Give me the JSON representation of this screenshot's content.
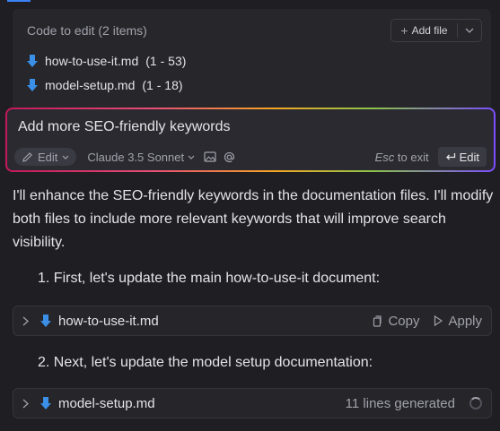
{
  "code_to_edit": {
    "header": "Code to edit (2 items)",
    "add_file_label": "Add file",
    "files": [
      {
        "name": "how-to-use-it.md",
        "range": "(1 - 53)"
      },
      {
        "name": "model-setup.md",
        "range": "(1 - 18)"
      }
    ]
  },
  "prompt": {
    "text": "Add more SEO-friendly keywords",
    "mode_label": "Edit",
    "model_label": "Claude 3.5 Sonnet",
    "esc_key": "Esc",
    "esc_hint": "to exit",
    "submit_label": "Edit"
  },
  "response": {
    "intro": "I'll enhance the SEO-friendly keywords in the documentation files. I'll modify both files to include more relevant keywords that will improve search visibility.",
    "step1": "1. First, let's update the main how-to-use-it document:",
    "step2": "2. Next, let's update the model setup documentation:"
  },
  "code_blocks": [
    {
      "name": "how-to-use-it.md",
      "copy_label": "Copy",
      "apply_label": "Apply"
    },
    {
      "name": "model-setup.md",
      "status": "11 lines generated"
    }
  ],
  "colors": {
    "background": "#1f1f23",
    "markdown_icon": "#3b8fe6",
    "accent": "#3b82f6"
  }
}
